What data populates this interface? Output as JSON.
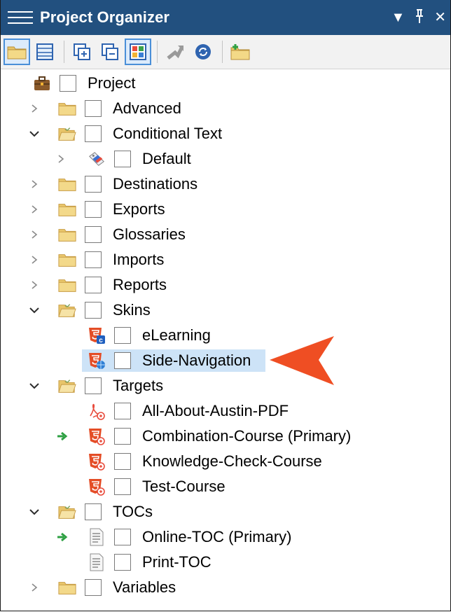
{
  "window": {
    "title": "Project Organizer"
  },
  "title_controls": {
    "dropdown": "▼",
    "pin": "ꟼ",
    "close": "✕"
  },
  "toolbar": {
    "buttons": [
      {
        "name": "folder-view-button",
        "icon": "folder-icon"
      },
      {
        "name": "list-view-button",
        "icon": "list-icon"
      },
      {
        "name": "expand-all-button",
        "icon": "expand-all-icon"
      },
      {
        "name": "collapse-all-button",
        "icon": "collapse-all-icon"
      },
      {
        "name": "tile-view-button",
        "icon": "tile-icon"
      },
      {
        "name": "move-up-button",
        "icon": "up-arrow-icon"
      },
      {
        "name": "refresh-button",
        "icon": "refresh-icon"
      },
      {
        "name": "new-folder-button",
        "icon": "new-folder-icon"
      }
    ]
  },
  "tree": {
    "items": [
      {
        "label": "Project",
        "level": 0,
        "icon": "briefcase-icon",
        "expander": "none"
      },
      {
        "label": "Advanced",
        "level": 1,
        "icon": "folder-icon",
        "expander": "collapsed"
      },
      {
        "label": "Conditional Text",
        "level": 1,
        "icon": "folder-open-icon",
        "expander": "expanded"
      },
      {
        "label": "Default",
        "level": 2,
        "icon": "condition-tag-icon",
        "expander": "collapsed"
      },
      {
        "label": "Destinations",
        "level": 1,
        "icon": "folder-icon",
        "expander": "collapsed"
      },
      {
        "label": "Exports",
        "level": 1,
        "icon": "folder-icon",
        "expander": "collapsed"
      },
      {
        "label": "Glossaries",
        "level": 1,
        "icon": "folder-icon",
        "expander": "collapsed"
      },
      {
        "label": "Imports",
        "level": 1,
        "icon": "folder-icon",
        "expander": "collapsed"
      },
      {
        "label": "Reports",
        "level": 1,
        "icon": "folder-icon",
        "expander": "collapsed"
      },
      {
        "label": "Skins",
        "level": 1,
        "icon": "folder-open-icon",
        "expander": "expanded"
      },
      {
        "label": "eLearning",
        "level": 2,
        "icon": "html5-skin-icon",
        "expander": "none"
      },
      {
        "label": "Side-Navigation",
        "level": 2,
        "icon": "html5-skin-icon",
        "expander": "none",
        "selected": true
      },
      {
        "label": "Targets",
        "level": 1,
        "icon": "folder-open-icon",
        "expander": "expanded"
      },
      {
        "label": "All-About-Austin-PDF",
        "level": 2,
        "icon": "pdf-target-icon",
        "expander": "none"
      },
      {
        "label": "Combination-Course (Primary)",
        "level": 2,
        "icon": "html5-target-icon",
        "expander": "none",
        "primary": true
      },
      {
        "label": "Knowledge-Check-Course",
        "level": 2,
        "icon": "html5-target-icon",
        "expander": "none"
      },
      {
        "label": "Test-Course",
        "level": 2,
        "icon": "html5-target-icon",
        "expander": "none"
      },
      {
        "label": "TOCs",
        "level": 1,
        "icon": "folder-open-icon",
        "expander": "expanded"
      },
      {
        "label": "Online-TOC (Primary)",
        "level": 2,
        "icon": "toc-icon",
        "expander": "none",
        "primary": true
      },
      {
        "label": "Print-TOC",
        "level": 2,
        "icon": "toc-icon",
        "expander": "none"
      },
      {
        "label": "Variables",
        "level": 1,
        "icon": "folder-icon",
        "expander": "collapsed"
      }
    ]
  },
  "colors": {
    "titlebar": "#22507f",
    "selection": "#cde3f7",
    "callout": "#ef4e23",
    "primary_marker": "#2ea043"
  }
}
